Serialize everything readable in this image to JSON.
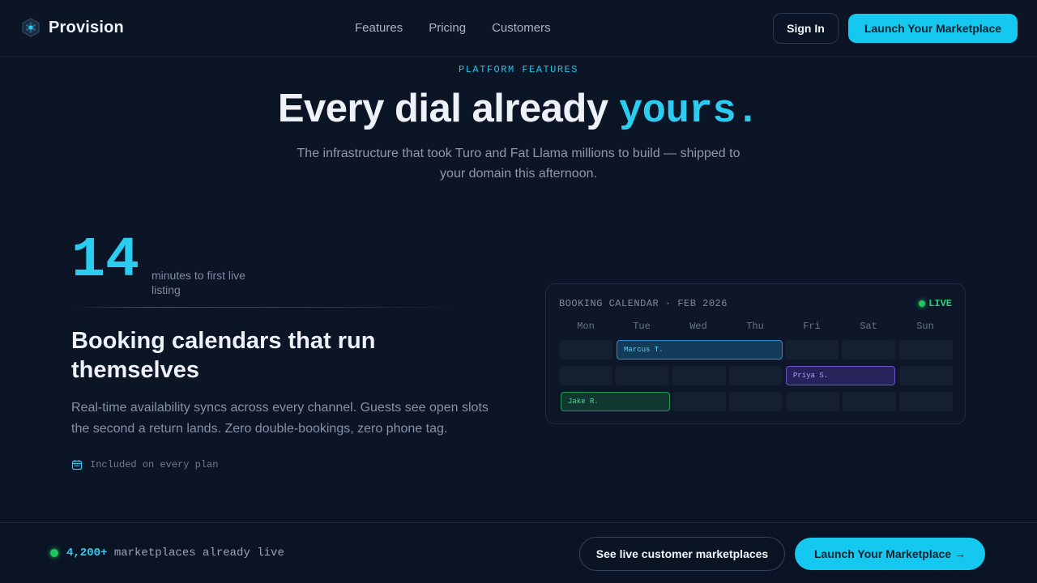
{
  "nav": {
    "brand": "Provision",
    "links": [
      "Features",
      "Pricing",
      "Customers"
    ],
    "sign_in": "Sign In",
    "launch": "Launch Your Marketplace"
  },
  "hero": {
    "eyebrow": "PLATFORM FEATURES",
    "headline_main": "Every dial already ",
    "headline_accent": "yours.",
    "subline": "The infrastructure that took Turo and Fat Llama millions to build — shipped to your domain this afternoon."
  },
  "feature": {
    "stat_value": "14",
    "stat_caption": "minutes to first live listing",
    "title": "Booking calendars that run themselves",
    "description": "Real-time availability syncs across every channel. Guests see open slots the second a return lands. Zero double-bookings, zero phone tag.",
    "included": "Included on every plan"
  },
  "calendar": {
    "title": "BOOKING CALENDAR · FEB 2026",
    "live": "LIVE",
    "days": [
      "Mon",
      "Tue",
      "Wed",
      "Thu",
      "Fri",
      "Sat",
      "Sun"
    ],
    "bookings": [
      {
        "guest": "Marcus T.",
        "start": "Tue",
        "end": "Thu",
        "row": 1,
        "color": "#2a8fc1"
      },
      {
        "guest": "Priya S.",
        "start": "Fri",
        "end": "Sat",
        "row": 2,
        "color": "#6d4fc8"
      },
      {
        "guest": "Jake R.",
        "start": "Mon",
        "end": "Tue",
        "row": 3,
        "color": "#23965a"
      }
    ]
  },
  "bottom": {
    "count": "4,200+",
    "status_text": " marketplaces already live",
    "see_live": "See live customer marketplaces",
    "launch": "Launch Your Marketplace →"
  },
  "colors": {
    "background": "#0b1526",
    "accent": "#14c8f0",
    "live_green": "#22c55e"
  }
}
